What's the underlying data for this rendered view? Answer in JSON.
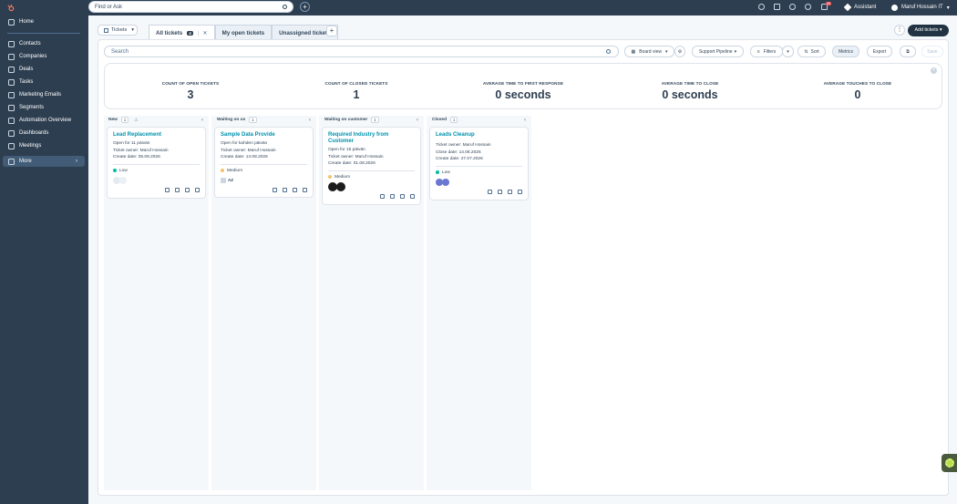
{
  "sidebar": {
    "items": [
      {
        "label": "Home",
        "icon": "home-icon"
      },
      {
        "label": "Contacts",
        "icon": "contacts-icon"
      },
      {
        "label": "Companies",
        "icon": "companies-icon"
      },
      {
        "label": "Deals",
        "icon": "deals-icon"
      },
      {
        "label": "Tasks",
        "icon": "tasks-icon"
      },
      {
        "label": "Marketing Emails",
        "icon": "email-icon"
      },
      {
        "label": "Segments",
        "icon": "segments-icon"
      },
      {
        "label": "Automation Overview",
        "icon": "automation-icon"
      },
      {
        "label": "Dashboards",
        "icon": "dashboards-icon"
      },
      {
        "label": "Meetings",
        "icon": "meetings-icon"
      },
      {
        "label": "More",
        "icon": "more-icon"
      }
    ]
  },
  "topbar": {
    "search_placeholder": "Find or Ask",
    "notification_count": "10",
    "assistant_label": "Assistant",
    "user_name": "Maruf Hossain IT"
  },
  "toolbar": {
    "object_label": "Tickets",
    "tabs": [
      {
        "label": "All tickets",
        "count": "4"
      },
      {
        "label": "My open tickets"
      },
      {
        "label": "Unassigned tickets"
      }
    ],
    "add_tickets_label": "Add tickets"
  },
  "controls": {
    "search_placeholder": "Search",
    "board_view_label": "Board view",
    "pipeline_label": "Support Pipeline",
    "filters_label": "Filters",
    "sort_label": "Sort",
    "metrics_label": "Metrics",
    "export_label": "Export",
    "save_label": "Save"
  },
  "metrics": [
    {
      "label": "COUNT OF OPEN TICKETS",
      "value": "3"
    },
    {
      "label": "COUNT OF CLOSED TICKETS",
      "value": "1"
    },
    {
      "label": "AVERAGE TIME TO FIRST RESPONSE",
      "value": "0 seconds"
    },
    {
      "label": "AVERAGE TIME TO CLOSE",
      "value": "0 seconds"
    },
    {
      "label": "AVERAGE TOUCHES TO CLOSE",
      "value": "0"
    }
  ],
  "columns": [
    {
      "name": "New",
      "count": "1",
      "card": {
        "title": "Lead Replacement",
        "lines": [
          "Open for 11 päivän",
          "Ticket owner: Maruf Hossain",
          "Create date: 05.08.2026"
        ],
        "priority": "Low",
        "priority_color": "#00bda5"
      }
    },
    {
      "name": "Waiting on us",
      "count": "1",
      "card": {
        "title": "Sample Data Provide",
        "lines": [
          "Open for kahden päivän",
          "Ticket owner: Maruf Hossain",
          "Create date: 14.08.2026"
        ],
        "priority": "Medium",
        "priority_color": "#f5c26b",
        "badge": "AZ"
      }
    },
    {
      "name": "Waiting on customer",
      "count": "1",
      "card": {
        "title": "Required Industry from Customer",
        "lines": [
          "Open for 15 päivän",
          "Ticket owner: Maruf Hossain",
          "Create date: 01.08.2026"
        ],
        "priority": "Medium",
        "priority_color": "#f5c26b"
      }
    },
    {
      "name": "Closed",
      "count": "1",
      "card": {
        "title": "Leads Cleanup",
        "lines": [
          "Ticket owner: Maruf Hossain",
          "Close date: 14.08.2026",
          "Create date: 27.07.2026"
        ],
        "priority": "Low",
        "priority_color": "#00bda5"
      }
    }
  ],
  "colors": {
    "nav_bg": "#2d3e50",
    "accent_link": "#0091ae",
    "primary_button": "#213343"
  }
}
